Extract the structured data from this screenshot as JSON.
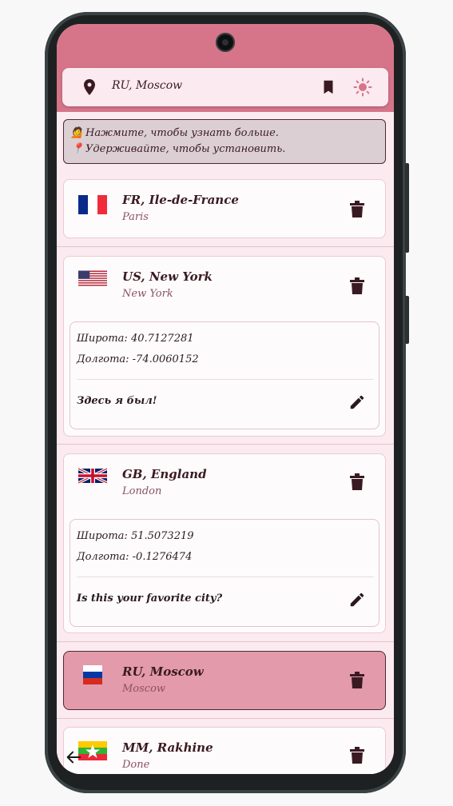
{
  "header": {
    "title": "RU, Moscow",
    "icons": [
      "location-pin-icon",
      "bookmark-icon",
      "sun-icon"
    ]
  },
  "hint": {
    "line1_emoji": "💁",
    "line1": "Нажмите, чтобы узнать больше.",
    "line2_emoji": "📍",
    "line2": "Удерживайте, чтобы установить."
  },
  "locations": [
    {
      "flag": "FR",
      "name": "FR, Ile-de-France",
      "city": "Paris"
    },
    {
      "flag": "US",
      "name": "US, New York",
      "city": "New York",
      "latitude": "Широта: 40.7127281",
      "longitude": "Долгота: -74.0060152",
      "note": "Здесь я был!"
    },
    {
      "flag": "GB",
      "name": "GB, England",
      "city": "London",
      "latitude": "Широта: 51.5073219",
      "longitude": "Долгота: -0.1276474",
      "note": "Is this your favorite city?"
    },
    {
      "flag": "RU",
      "name": "RU, Moscow",
      "city": "Moscow",
      "selected": true
    },
    {
      "flag": "MM",
      "name": "MM, Rakhine",
      "city": "Done"
    }
  ],
  "colors": {
    "accent": "#d67589",
    "background": "#fbeaf0",
    "selected_card": "#e39aaa",
    "text": "#3a1a22"
  }
}
